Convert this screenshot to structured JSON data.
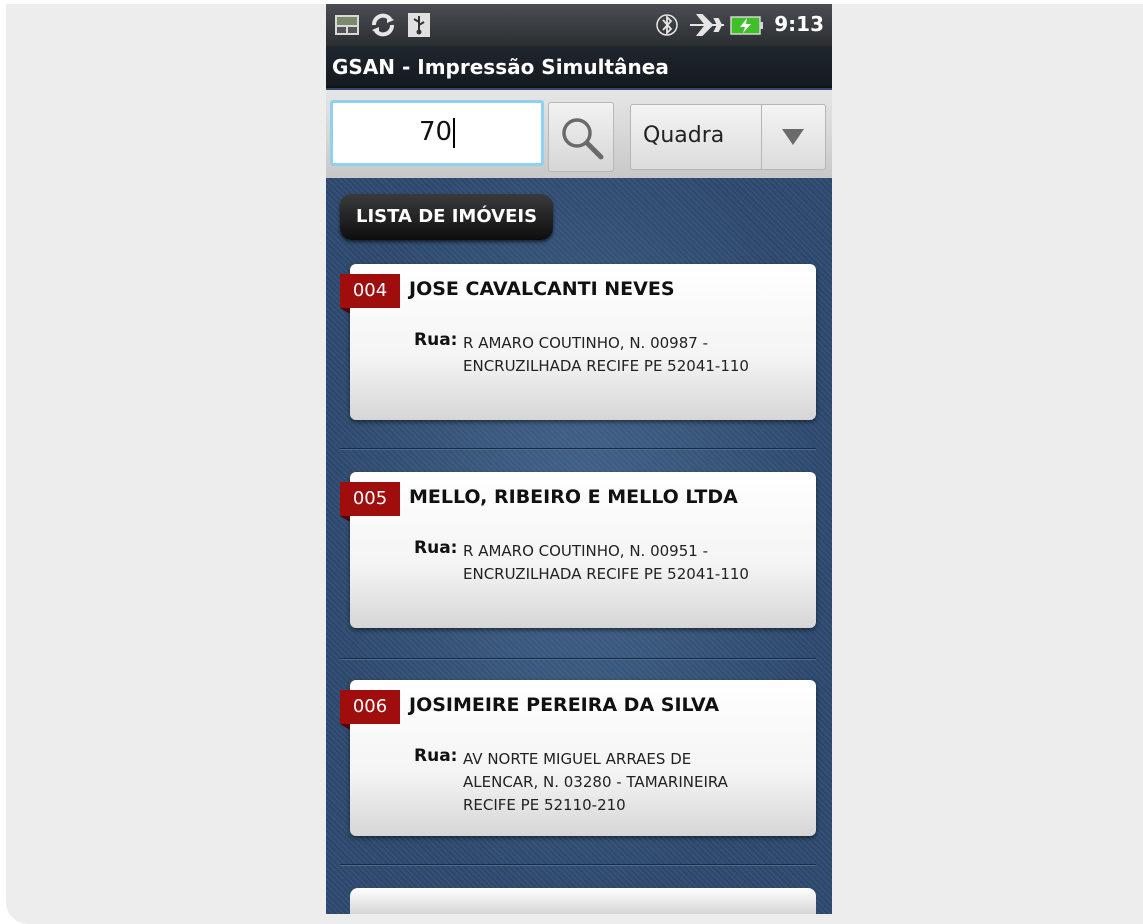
{
  "status_bar": {
    "time": "9:13",
    "left_icons": [
      "screenshot-icon",
      "sync-icon",
      "usb-icon"
    ],
    "right_icons": [
      "bluetooth-icon",
      "airplane-mode-icon",
      "battery-charging-icon"
    ]
  },
  "app": {
    "title": "GSAN - Impressão Simultânea"
  },
  "search": {
    "value": "70",
    "filter_selected": "Quadra"
  },
  "list": {
    "title": "LISTA DE IMÓVEIS",
    "items": [
      {
        "number": "004",
        "name": "JOSE CAVALCANTI NEVES",
        "address_label": "Rua:",
        "address_lines": [
          "R AMARO COUTINHO, N. 00987 -",
          "ENCRUZILHADA RECIFE PE 52041-110"
        ]
      },
      {
        "number": "005",
        "name": "MELLO, RIBEIRO E MELLO LTDA",
        "address_label": "Rua:",
        "address_lines": [
          "R AMARO COUTINHO, N. 00951 -",
          "ENCRUZILHADA RECIFE PE 52041-110"
        ]
      },
      {
        "number": "006",
        "name": "JOSIMEIRE PEREIRA DA SILVA",
        "address_label": "Rua:",
        "address_lines": [
          "AV NORTE MIGUEL ARRAES DE",
          "ALENCAR, N. 03280 - TAMARINEIRA",
          "RECIFE PE 52110-210"
        ]
      }
    ]
  },
  "colors": {
    "badge_red": "#a00d0d",
    "background_blue": "#2e4a6f",
    "input_focus": "#8ed2f0"
  }
}
